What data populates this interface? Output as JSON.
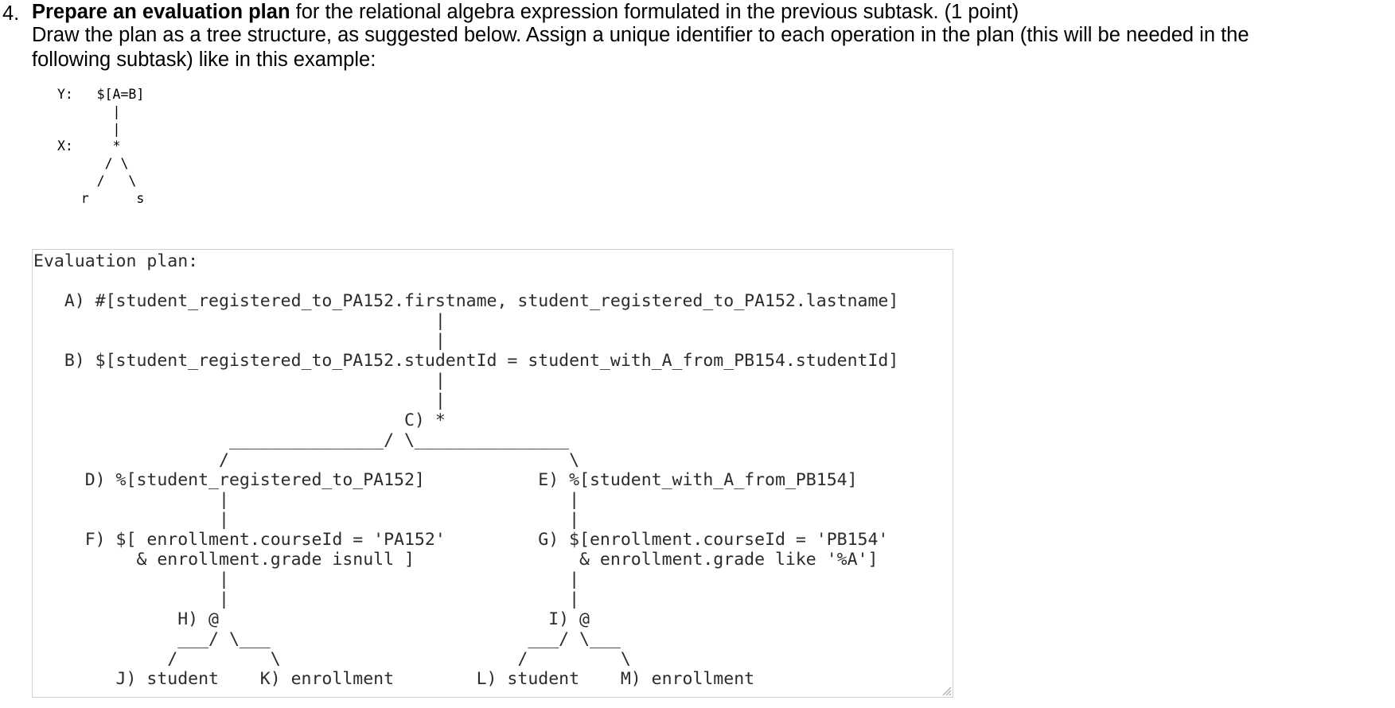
{
  "question": {
    "number": "4.",
    "title_bold": "Prepare an evaluation plan",
    "title_rest": " for the relational algebra expression formulated in the previous subtask. (1 point)",
    "description_line1": "Draw the plan as a tree structure, as suggested below. Assign a unique identifier to each operation in the plan (this will be needed in the",
    "description_line2": "following subtask) like in this example:"
  },
  "example": {
    "plan_text": "Y:   $[A=B]\n       |\n       |\nX:     *\n      / \\\n     /   \\\n   r      s"
  },
  "answer": {
    "text": "Evaluation plan:\n\n   A) #[student_registered_to_PA152.firstname, student_registered_to_PA152.lastname]\n                                       |\n                                       |\n   B) $[student_registered_to_PA152.studentId = student_with_A_from_PB154.studentId]\n                                       |\n                                       |\n                                    C) *\n                   _______________/ \\_______________\n                  /                                 \\\n     D) %[student_registered_to_PA152]           E) %[student_with_A_from_PB154]\n                  |                                 |\n                  |                                 |\n     F) $[ enrollment.courseId = 'PA152'         G) $[enrollment.courseId = 'PB154'\n          & enrollment.grade isnull ]                & enrollment.grade like '%A']\n                  |                                 |\n                  |                                 |\n              H) @                                I) @\n              ___/ \\___                         ___/ \\___\n             /         \\                       /         \\\n        J) student    K) enrollment        L) student    M) enrollment"
  }
}
